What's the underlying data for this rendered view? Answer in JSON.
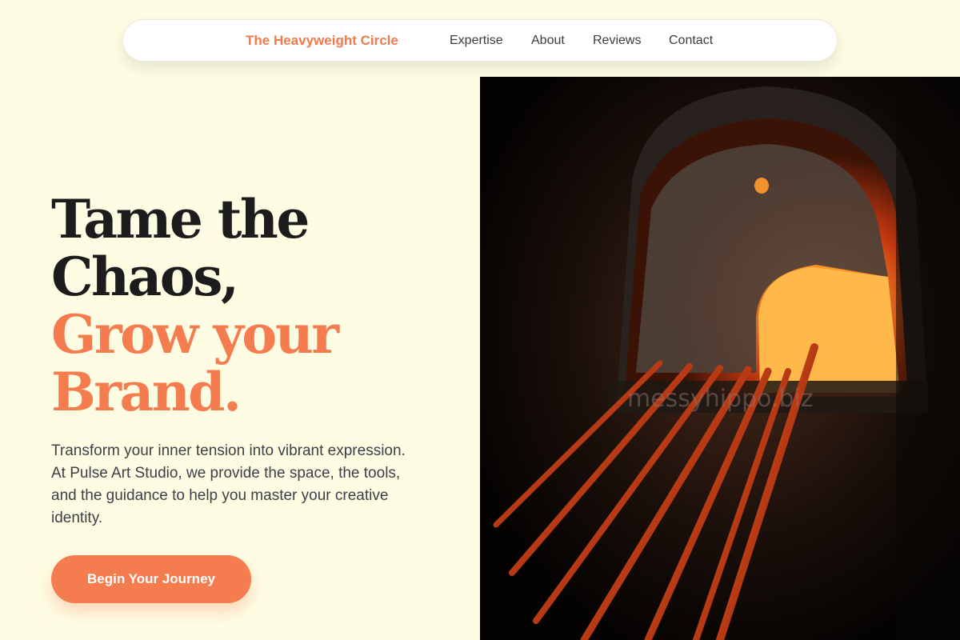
{
  "nav": {
    "brand": "The Heavyweight Circle",
    "links": [
      "Expertise",
      "About",
      "Reviews",
      "Contact"
    ]
  },
  "hero": {
    "title_line1": "Tame the",
    "title_line2": "Chaos,",
    "title_accent_line1": "Grow your",
    "title_accent_line2": "Brand.",
    "description": "Transform your inner tension into vibrant expression. At Pulse Art Studio, we provide the space, the tools, and the guidance to help you master your creative identity.",
    "cta_label": "Begin Your Journey"
  },
  "image": {
    "watermark": "messyhippo.biz"
  },
  "colors": {
    "background": "#fefde4",
    "accent": "#f47c4e",
    "heading": "#1c1c1c",
    "body_text": "#3c3f47"
  }
}
